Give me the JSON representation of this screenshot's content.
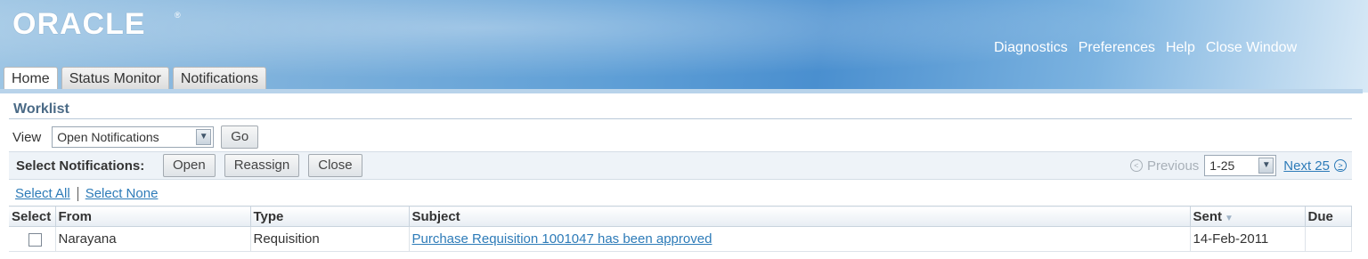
{
  "header": {
    "logo_text": "ORACLE",
    "logo_mark": "®",
    "global_links": [
      "Diagnostics",
      "Preferences",
      "Help",
      "Close Window"
    ]
  },
  "tabs": [
    {
      "label": "Home",
      "active": true
    },
    {
      "label": "Status Monitor",
      "active": false
    },
    {
      "label": "Notifications",
      "active": false
    }
  ],
  "worklist": {
    "title": "Worklist",
    "view_label": "View",
    "view_value": "Open Notifications",
    "go_label": "Go",
    "select_label": "Select Notifications:",
    "actions": [
      "Open",
      "Reassign",
      "Close"
    ],
    "pager": {
      "previous": "Previous",
      "range": "1-25",
      "next": "Next 25"
    },
    "select_all": "Select All",
    "select_none": "Select None"
  },
  "table": {
    "columns": [
      "Select",
      "From",
      "Type",
      "Subject",
      "Sent",
      "Due"
    ],
    "rows": [
      {
        "from": "Narayana",
        "type": "Requisition",
        "subject": "Purchase Requisition 1001047 has been approved",
        "sent": "14-Feb-2011",
        "due": ""
      }
    ]
  }
}
